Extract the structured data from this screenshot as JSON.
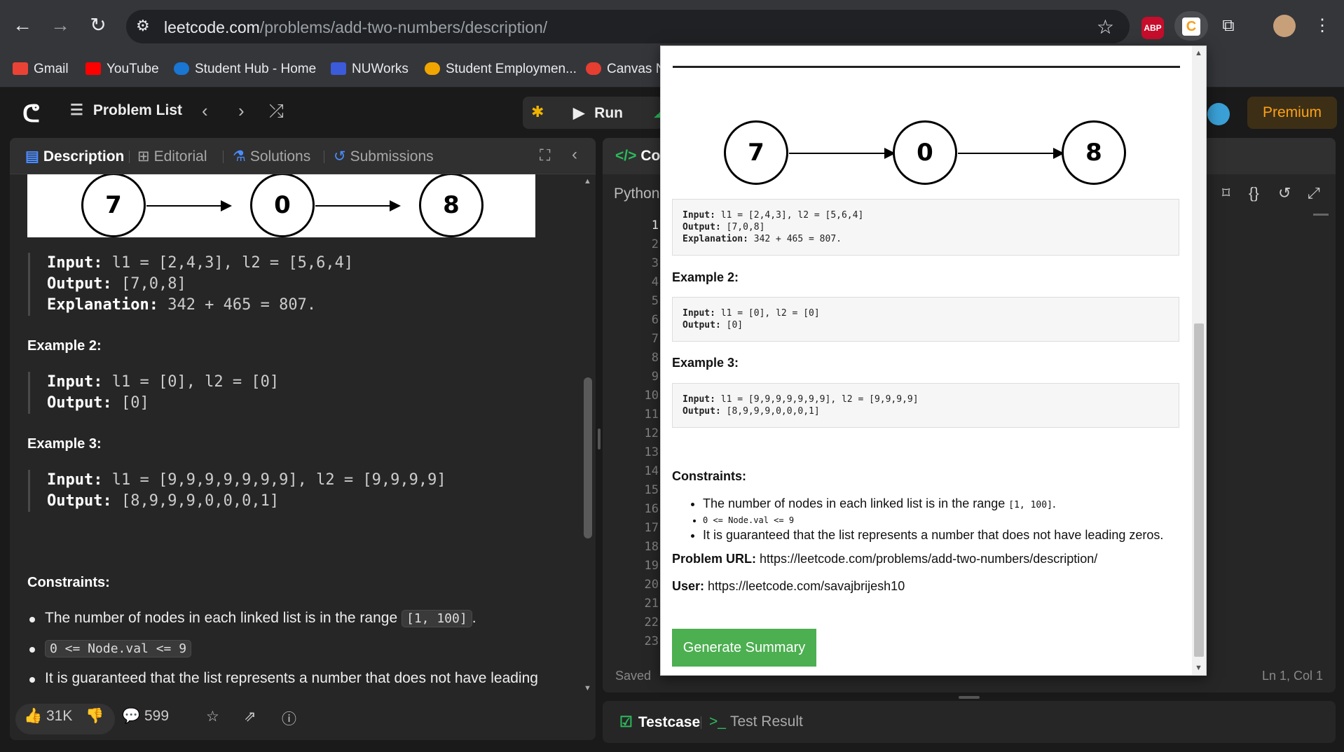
{
  "browser": {
    "url_host": "leetcode.com",
    "url_path": "/problems/add-two-numbers/description/",
    "abp_label": "ABP",
    "bookmarks": [
      {
        "label": "Gmail",
        "color": "#ea4335"
      },
      {
        "label": "YouTube",
        "color": "#ff0000"
      },
      {
        "label": "Student Hub - Home",
        "color": "#1976d2"
      },
      {
        "label": "NUWorks",
        "color": "#3b5bdb"
      },
      {
        "label": "Student Employmen...",
        "color": "#f0a500"
      },
      {
        "label": "Canvas N",
        "color": "#e63e30"
      }
    ]
  },
  "header": {
    "problem_list": "Problem List",
    "run_label": "Run",
    "premium_label": "Premium"
  },
  "left": {
    "tabs": [
      "Description",
      "Editorial",
      "Solutions",
      "Submissions"
    ],
    "diagram_nodes": [
      "7",
      "0",
      "8"
    ],
    "example1": {
      "input_label": "Input:",
      "input": "l1 = [2,4,3], l2 = [5,6,4]",
      "output_label": "Output:",
      "output": "[7,0,8]",
      "explanation_label": "Explanation:",
      "explanation": "342 + 465 = 807."
    },
    "example2_title": "Example 2:",
    "example2": {
      "input_label": "Input:",
      "input": "l1 = [0], l2 = [0]",
      "output_label": "Output:",
      "output": "[0]"
    },
    "example3_title": "Example 3:",
    "example3": {
      "input_label": "Input:",
      "input": "l1 = [9,9,9,9,9,9,9], l2 = [9,9,9,9]",
      "output_label": "Output:",
      "output": "[8,9,9,9,0,0,0,1]"
    },
    "constraints_title": "Constraints:",
    "constraint1_text": "The number of nodes in each linked list is in the range",
    "constraint1_code": "[1, 100]",
    "constraint1_end": ".",
    "constraint2_code": "0 <= Node.val <= 9",
    "constraint3_text": "It is guaranteed that the list represents a number that does not have leading",
    "likes": "31K",
    "comments": "599"
  },
  "editor": {
    "tab_label": "Coc",
    "language": "Python",
    "line_numbers": [
      "1",
      "2",
      "3",
      "4",
      "5",
      "6",
      "7",
      "8",
      "9",
      "10",
      "11",
      "12",
      "13",
      "14",
      "15",
      "16",
      "17",
      "18",
      "19",
      "20",
      "21",
      "22",
      "23"
    ],
    "saved": "Saved",
    "cursor": "Ln 1, Col 1"
  },
  "testpanel": {
    "testcase": "Testcase",
    "test_result": "Test Result"
  },
  "popup": {
    "nodes": [
      "7",
      "0",
      "8"
    ],
    "ex1_input_label": "Input:",
    "ex1_input": "l1 = [2,4,3], l2 = [5,6,4]",
    "ex1_output_label": "Output:",
    "ex1_output": "[7,0,8]",
    "ex1_expl_label": "Explanation:",
    "ex1_expl": "342 + 465 = 807.",
    "ex2_title": "Example 2:",
    "ex2_input_label": "Input:",
    "ex2_input": "l1 = [0], l2 = [0]",
    "ex2_output_label": "Output:",
    "ex2_output": "[0]",
    "ex3_title": "Example 3:",
    "ex3_input_label": "Input:",
    "ex3_input": "l1 = [9,9,9,9,9,9,9], l2 = [9,9,9,9]",
    "ex3_output_label": "Output:",
    "ex3_output": "[8,9,9,9,0,0,0,1]",
    "constraints_title": "Constraints:",
    "c1_text": "The number of nodes in each linked list is in the range",
    "c1_code": "[1, 100]",
    "c1_end": ".",
    "c2": "0 <= Node.val <= 9",
    "c3": "It is guaranteed that the list represents a number that does not have leading zeros.",
    "problem_url_label": "Problem URL:",
    "problem_url": "https://leetcode.com/problems/add-two-numbers/description/",
    "user_label": "User:",
    "user_url": "https://leetcode.com/savajbrijesh10",
    "button": "Generate Summary"
  }
}
